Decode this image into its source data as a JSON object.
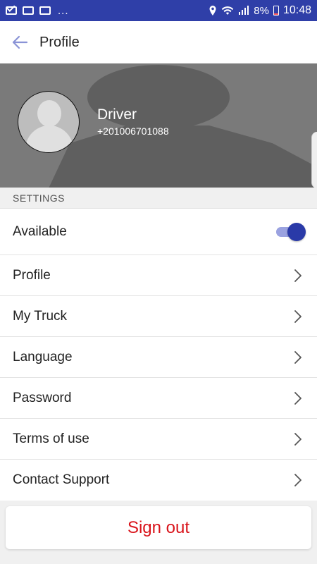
{
  "status_bar": {
    "left_dots": "...",
    "battery": "8%",
    "time": "10:48"
  },
  "app_bar": {
    "title": "Profile"
  },
  "profile": {
    "name": "Driver",
    "phone": "+201006701088"
  },
  "settings": {
    "section_label": "SETTINGS",
    "available": {
      "label": "Available",
      "on": true
    },
    "items": [
      {
        "label": "Profile"
      },
      {
        "label": "My Truck"
      },
      {
        "label": "Language"
      },
      {
        "label": "Password"
      },
      {
        "label": "Terms of use"
      },
      {
        "label": "Contact Support"
      }
    ]
  },
  "sign_out_label": "Sign out",
  "colors": {
    "status_bar": "#2f3fa8",
    "accent": "#2a3aa8",
    "sign_out": "#d9141b"
  },
  "icons": {
    "back": "arrow-left-icon",
    "chevron": "chevron-right-icon",
    "avatar": "person-placeholder-icon"
  }
}
